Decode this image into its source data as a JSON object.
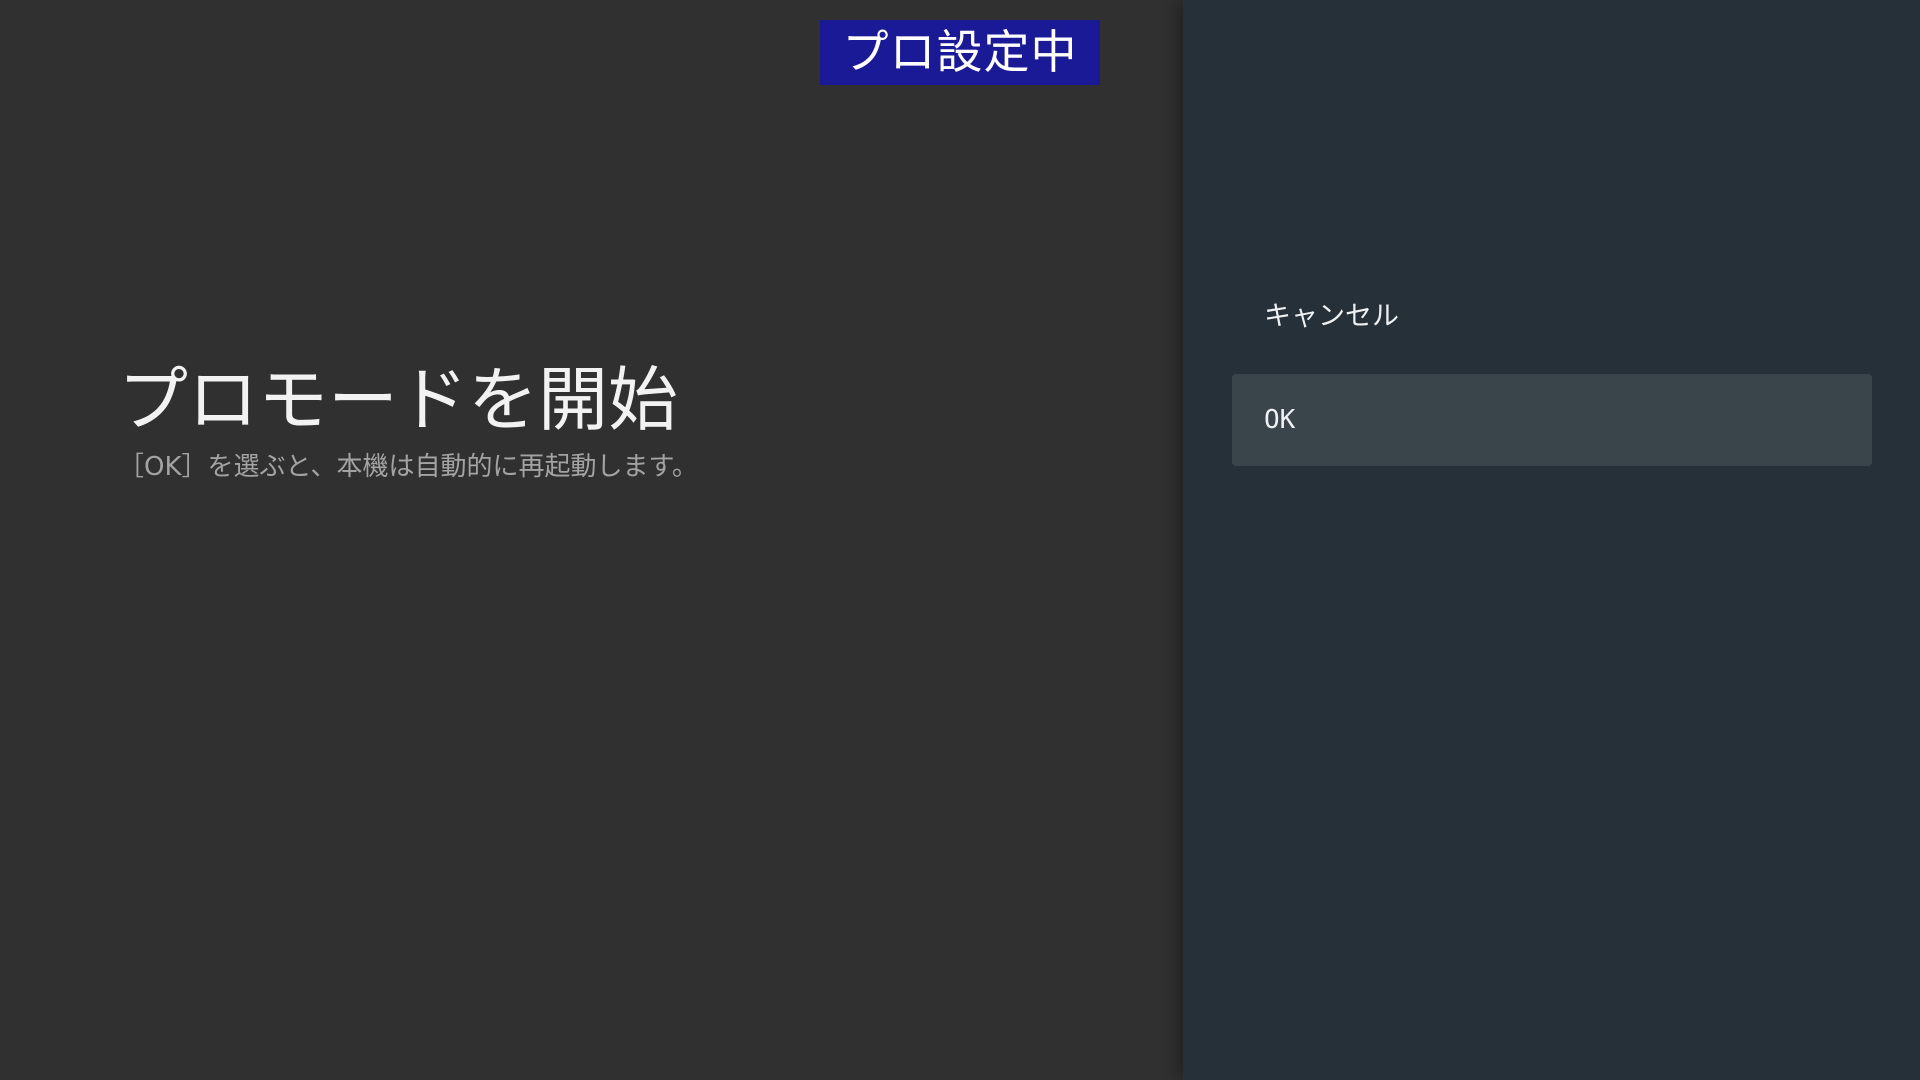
{
  "badge": {
    "text": "プロ設定中",
    "background": "#1a1a96"
  },
  "dialog": {
    "title": "プロモードを開始",
    "description": "［OK］を選ぶと、本機は自動的に再起動します。"
  },
  "actions": [
    {
      "label": "キャンセル",
      "focused": false
    },
    {
      "label": "OK",
      "focused": true
    }
  ],
  "colors": {
    "left_background": "#303030",
    "right_background": "#263038",
    "focused_item": "#3a444b"
  }
}
